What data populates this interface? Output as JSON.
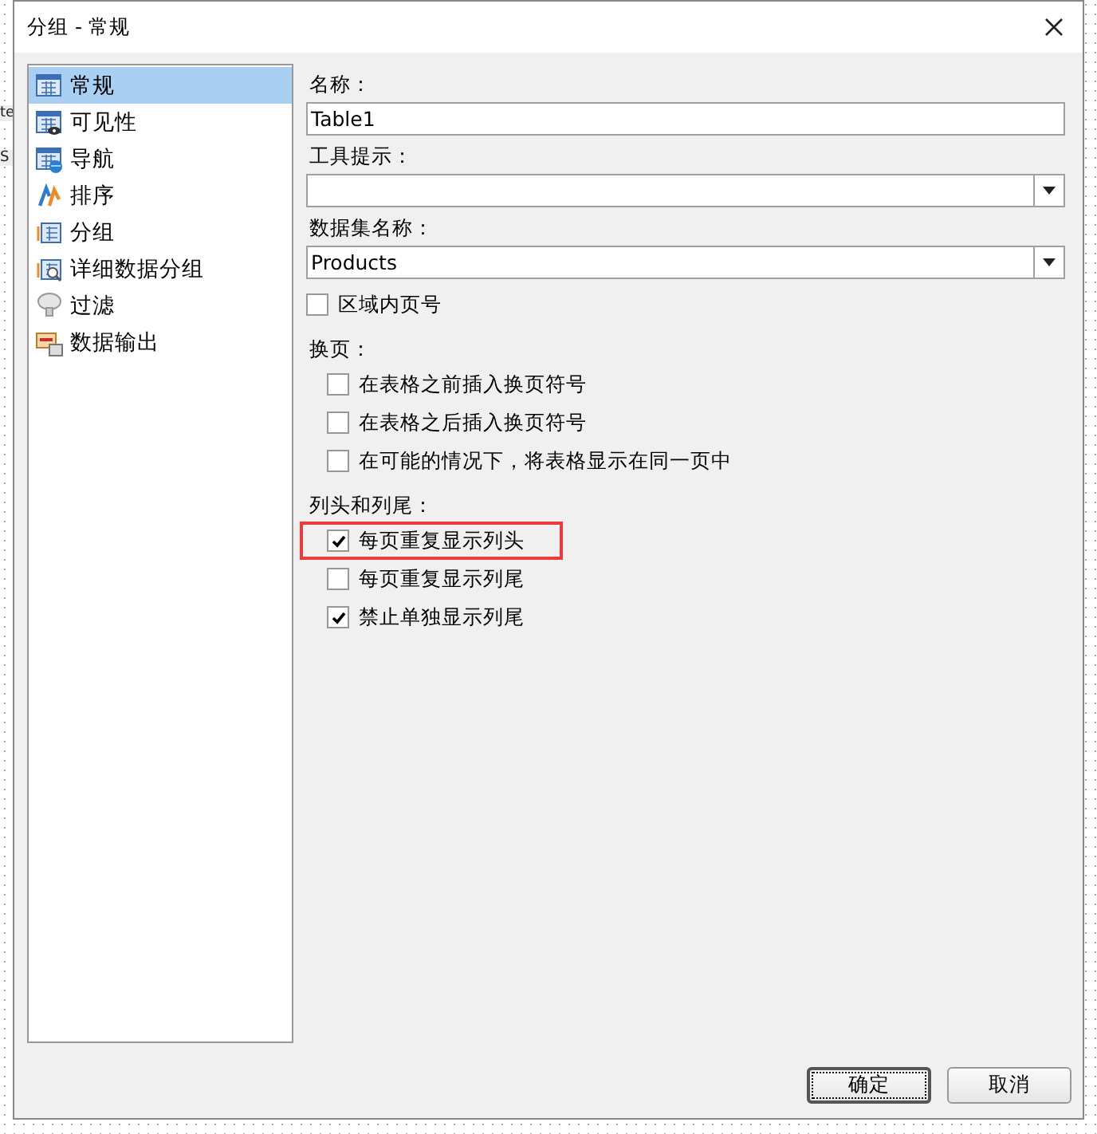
{
  "background": {
    "fragments": [
      "te",
      "S"
    ]
  },
  "window": {
    "title": "分组 - 常规"
  },
  "nav": [
    {
      "label": "常规",
      "kind": "grid",
      "selected": true
    },
    {
      "label": "可见性",
      "kind": "eye",
      "selected": false
    },
    {
      "label": "导航",
      "kind": "globe",
      "selected": false
    },
    {
      "label": "排序",
      "kind": "sort",
      "selected": false
    },
    {
      "label": "分组",
      "kind": "group",
      "selected": false
    },
    {
      "label": "详细数据分组",
      "kind": "detail",
      "selected": false
    },
    {
      "label": "过滤",
      "kind": "filter",
      "selected": false
    },
    {
      "label": "数据输出",
      "kind": "export",
      "selected": false
    }
  ],
  "fields": [
    {
      "kind": "text",
      "label": "名称：",
      "value": "Table1"
    },
    {
      "kind": "combo",
      "label": "工具提示："
    },
    {
      "kind": "combo",
      "label": "数据集名称：",
      "value": "Products"
    }
  ],
  "page_number_option": {
    "label": "区域内页号",
    "checked": false
  },
  "sections": [
    {
      "heading": "换页：",
      "options": [
        {
          "label": "在表格之前插入换页符号",
          "checked": false,
          "highlighted": false
        },
        {
          "label": "在表格之后插入换页符号",
          "checked": false,
          "highlighted": false
        },
        {
          "label": "在可能的情况下，将表格显示在同一页中",
          "checked": false,
          "highlighted": false
        }
      ]
    },
    {
      "heading": "列头和列尾：",
      "options": [
        {
          "label": "每页重复显示列头",
          "checked": true,
          "highlighted": true
        },
        {
          "label": "每页重复显示列尾",
          "checked": false,
          "highlighted": false
        },
        {
          "label": "禁止单独显示列尾",
          "checked": true,
          "highlighted": false
        }
      ]
    }
  ],
  "buttons": [
    {
      "label": "确定",
      "default": true
    },
    {
      "label": "取消",
      "default": false
    }
  ]
}
